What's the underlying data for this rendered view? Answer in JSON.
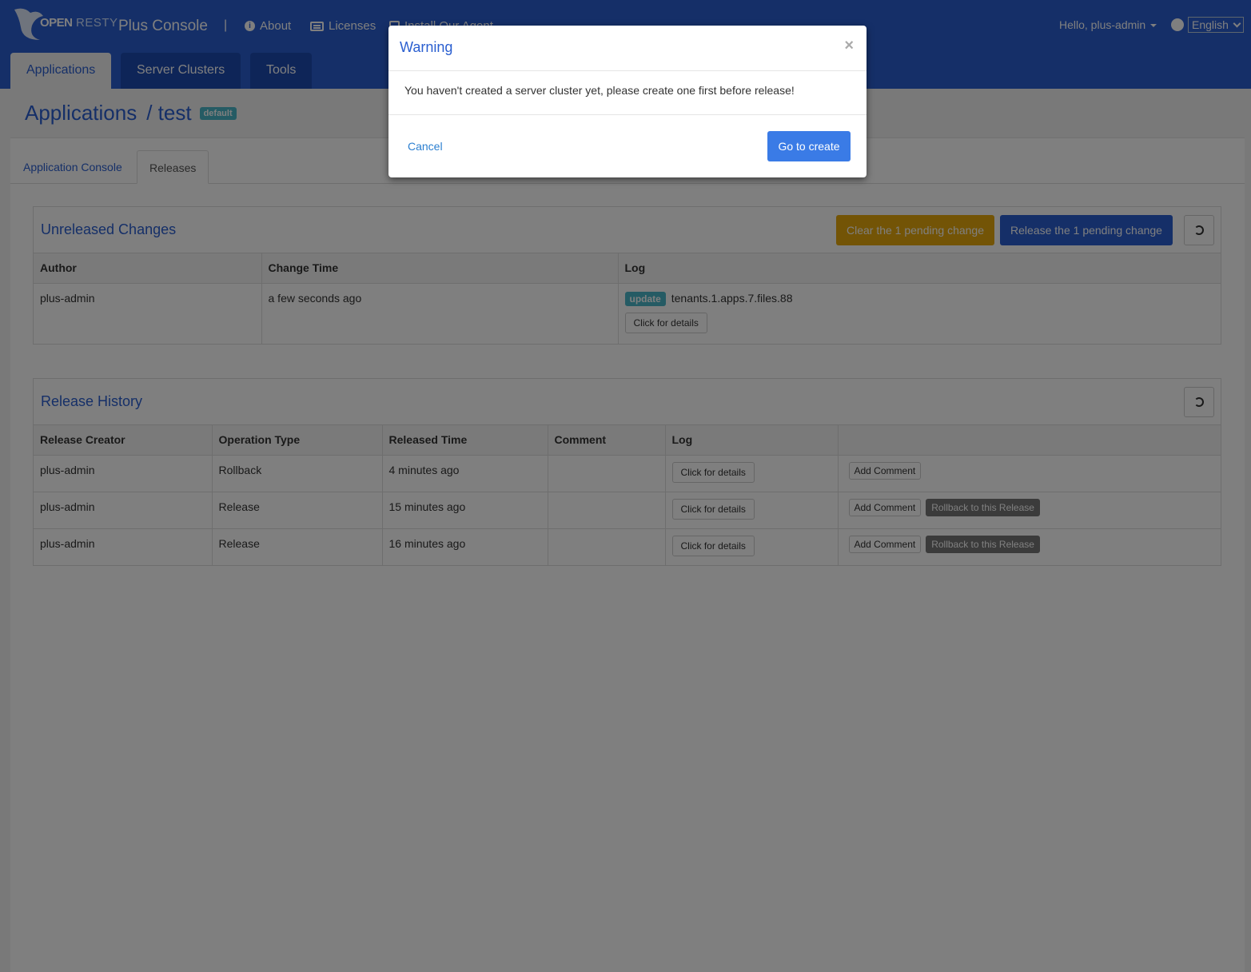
{
  "nav": {
    "brand_open": "OPEN",
    "brand_resty": "RESTY",
    "brand_name": "Plus Console",
    "separator": "|",
    "about": "About",
    "licenses": "Licenses",
    "install_agent": "Install Our Agent",
    "hello": "Hello, plus-admin",
    "language": "English"
  },
  "main_tabs": [
    "Applications",
    "Server Clusters",
    "Tools"
  ],
  "page": {
    "title": "Applications",
    "app_name": "/ test",
    "badge": "default"
  },
  "sub_tabs": [
    "Application Console",
    "Releases"
  ],
  "unreleased": {
    "title": "Unreleased Changes",
    "clear_btn": "Clear the 1 pending change",
    "release_btn": "Release the 1 pending change",
    "headers": [
      "Author",
      "Change Time",
      "Log"
    ],
    "rows": [
      {
        "author": "plus-admin",
        "time": "a few seconds ago",
        "badge": "update",
        "log": "tenants.1.apps.7.files.88",
        "details": "Click for details"
      }
    ]
  },
  "history": {
    "title": "Release History",
    "headers": [
      "Release Creator",
      "Operation Type",
      "Released Time",
      "Comment",
      "Log",
      ""
    ],
    "rows": [
      {
        "creator": "plus-admin",
        "op": "Rollback",
        "time": "4 minutes ago",
        "comment": "",
        "details": "Click for details",
        "add_comment": "Add Comment",
        "rollback": ""
      },
      {
        "creator": "plus-admin",
        "op": "Release",
        "time": "15 minutes ago",
        "comment": "",
        "details": "Click for details",
        "add_comment": "Add Comment",
        "rollback": "Rollback to this Release"
      },
      {
        "creator": "plus-admin",
        "op": "Release",
        "time": "16 minutes ago",
        "comment": "",
        "details": "Click for details",
        "add_comment": "Add Comment",
        "rollback": "Rollback to this Release"
      }
    ]
  },
  "modal": {
    "title": "Warning",
    "close": "×",
    "message": "You haven't created a server cluster yet, please create one first before release!",
    "cancel": "Cancel",
    "confirm": "Go to create"
  },
  "colors": {
    "primary": "#2b5fd0",
    "warning": "#e6a80c",
    "info": "#4ab7c8"
  }
}
